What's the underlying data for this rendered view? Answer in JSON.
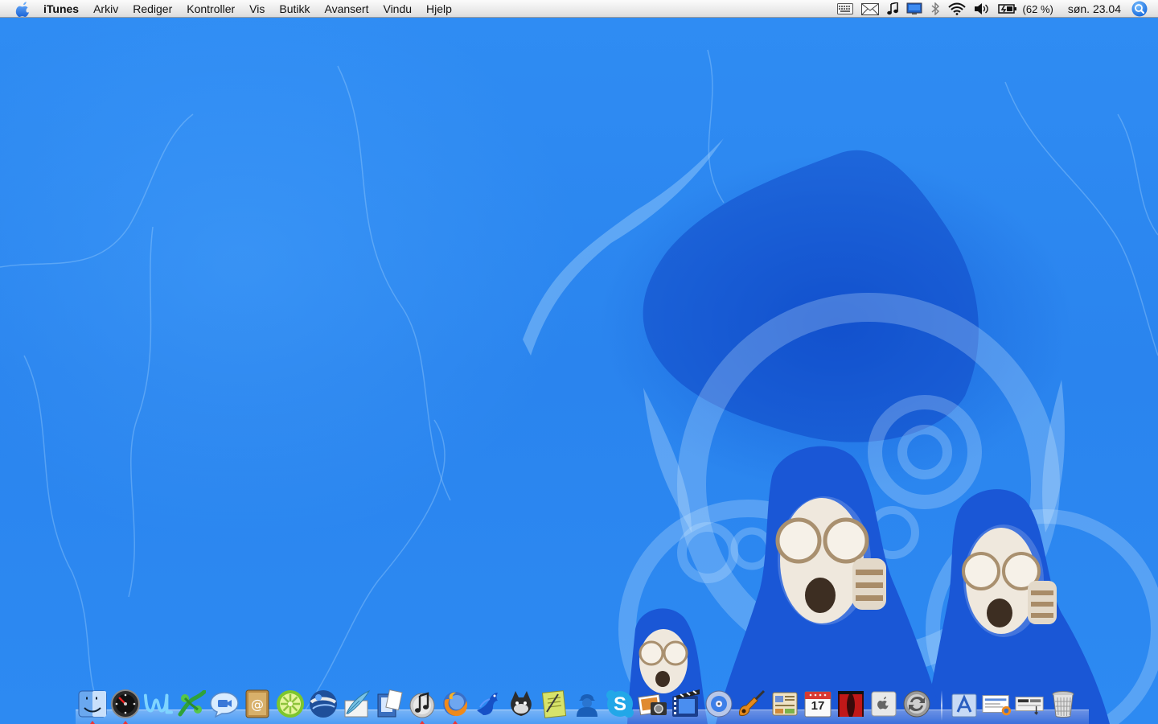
{
  "menubar": {
    "apple_icon": "apple-logo",
    "app_name": "iTunes",
    "menus": [
      "Arkiv",
      "Rediger",
      "Kontroller",
      "Vis",
      "Butikk",
      "Avansert",
      "Vindu",
      "Hjelp"
    ],
    "status": {
      "icons": [
        "keyboard-viewer-icon",
        "mail-icon",
        "music-note-icon",
        "display-icon",
        "bluetooth-icon",
        "wifi-icon",
        "volume-icon",
        "battery-icon"
      ],
      "battery": "(62 %)",
      "clock": "søn. 23.04",
      "spotlight_icon": "spotlight-icon"
    }
  },
  "dock": {
    "apps": [
      {
        "name": "Finder",
        "icon": "finder-icon",
        "running": true
      },
      {
        "name": "Dashboard",
        "icon": "dashboard-icon",
        "running": true
      },
      {
        "name": "Web",
        "icon": "web-app-icon",
        "running": false
      },
      {
        "name": "Cyberduck",
        "icon": "green-app-icon",
        "running": false
      },
      {
        "name": "iChat",
        "icon": "ichat-icon",
        "running": false
      },
      {
        "name": "Address Book",
        "icon": "address-book-icon",
        "running": false
      },
      {
        "name": "LimeWire",
        "icon": "limewire-icon",
        "running": false
      },
      {
        "name": "Google Earth",
        "icon": "google-earth-icon",
        "running": false
      },
      {
        "name": "TextEdit",
        "icon": "quill-icon",
        "running": false
      },
      {
        "name": "Preview",
        "icon": "preview-icon",
        "running": false
      },
      {
        "name": "iTunes",
        "icon": "itunes-icon",
        "running": true
      },
      {
        "name": "Firefox",
        "icon": "firefox-icon",
        "running": true
      },
      {
        "name": "Blue Bird",
        "icon": "blue-bird-icon",
        "running": false
      },
      {
        "name": "Camino",
        "icon": "dark-animal-icon",
        "running": false
      },
      {
        "name": "Notes",
        "icon": "notes-icon",
        "running": false
      },
      {
        "name": "Adium",
        "icon": "user-icon",
        "running": false
      },
      {
        "name": "Skype",
        "icon": "skype-icon",
        "running": false
      },
      {
        "name": "iPhoto",
        "icon": "iphoto-icon",
        "running": false
      },
      {
        "name": "iMovie",
        "icon": "imovie-icon",
        "running": false
      },
      {
        "name": "iDVD",
        "icon": "idvd-icon",
        "running": false
      },
      {
        "name": "GarageBand",
        "icon": "garageband-icon",
        "running": false
      },
      {
        "name": "iWeb",
        "icon": "iweb-icon",
        "running": false
      },
      {
        "name": "iCal",
        "icon": "ical-icon",
        "running": false,
        "date": "17"
      },
      {
        "name": "Front Row",
        "icon": "red-theater-icon",
        "running": false
      },
      {
        "name": "Boot Camp",
        "icon": "apple-box-icon",
        "running": false
      },
      {
        "name": "Sync",
        "icon": "sync-icon",
        "running": false
      }
    ],
    "stacks": [
      {
        "name": "Applications",
        "icon": "applications-stack-icon"
      },
      {
        "name": "Documents",
        "icon": "documents-stack-icon"
      },
      {
        "name": "Downloads",
        "icon": "downloads-stack-icon"
      },
      {
        "name": "Trash",
        "icon": "trash-icon"
      }
    ]
  },
  "colors": {
    "desktop": "#2a86ef",
    "menubar": "#ececec",
    "running_indicator": "#e33333"
  }
}
